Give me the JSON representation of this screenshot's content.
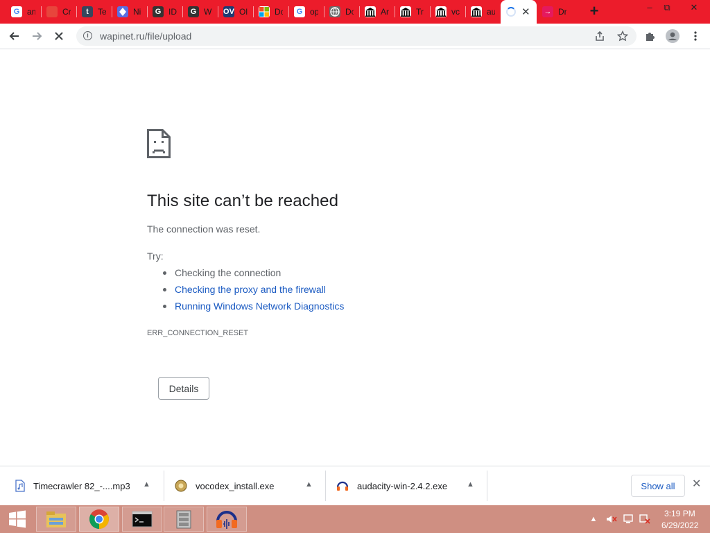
{
  "window": {
    "minimize_glyph": "–",
    "restore_glyph": "⧉",
    "close_glyph": "✕"
  },
  "tabs": [
    {
      "title": "an",
      "icon": "google-icon",
      "icon_text": "G",
      "icon_color": "#4285f4",
      "icon_bg": "#ffffff"
    },
    {
      "title": "Cr",
      "icon": "red-square-icon",
      "icon_text": "",
      "icon_color": "#ffffff",
      "icon_bg": "#e8453c"
    },
    {
      "title": "Te",
      "icon": "tumblr-icon",
      "icon_text": "t",
      "icon_color": "#ffffff",
      "icon_bg": "#36465d"
    },
    {
      "title": "Ni",
      "icon": "pen-nib-icon",
      "icon_text": "",
      "icon_color": "#ffffff",
      "icon_bg": "#5b6ee1"
    },
    {
      "title": "ID",
      "icon": "g-logo-icon",
      "icon_text": "G",
      "icon_color": "#ffffff",
      "icon_bg": "#333333"
    },
    {
      "title": "W",
      "icon": "g-logo-icon",
      "icon_text": "G",
      "icon_color": "#ffffff",
      "icon_bg": "#333333"
    },
    {
      "title": "Ol",
      "icon": "ov-icon",
      "icon_text": "OV",
      "icon_color": "#ffffff",
      "icon_bg": "#1f3b73"
    },
    {
      "title": "Dc",
      "icon": "microsoft-icon",
      "icon_text": "",
      "icon_color": "#ffffff",
      "icon_bg": "#ffffff"
    },
    {
      "title": "op",
      "icon": "google-icon",
      "icon_text": "G",
      "icon_color": "#4285f4",
      "icon_bg": "#ffffff"
    },
    {
      "title": "Do",
      "icon": "globe-icon",
      "icon_text": "",
      "icon_color": "#ffffff",
      "icon_bg": "#6b6b6b"
    },
    {
      "title": "Ar",
      "icon": "archive-icon",
      "icon_text": "",
      "icon_color": "#000000",
      "icon_bg": "#ffffff"
    },
    {
      "title": "Tr",
      "icon": "archive-icon",
      "icon_text": "",
      "icon_color": "#000000",
      "icon_bg": "#ffffff"
    },
    {
      "title": "vc",
      "icon": "archive-icon",
      "icon_text": "",
      "icon_color": "#000000",
      "icon_bg": "#ffffff"
    },
    {
      "title": "au",
      "icon": "archive-icon",
      "icon_text": "",
      "icon_color": "#000000",
      "icon_bg": "#ffffff"
    },
    {
      "title": "",
      "icon": "loading-spinner-icon",
      "icon_text": "",
      "icon_color": "#1a73e8",
      "icon_bg": "#ffffff",
      "active": true
    },
    {
      "title": "Dr",
      "icon": "arrow-right-icon",
      "icon_text": "→",
      "icon_color": "#ffffff",
      "icon_bg": "#e5195e"
    }
  ],
  "toolbar": {
    "url": "wapinet.ru/file/upload"
  },
  "error": {
    "title": "This site can’t be reached",
    "description": "The connection was reset.",
    "try_label": "Try:",
    "suggestions": [
      {
        "text": "Checking the connection",
        "link": false
      },
      {
        "text": "Checking the proxy and the firewall",
        "link": true
      },
      {
        "text": "Running Windows Network Diagnostics",
        "link": true
      }
    ],
    "code": "ERR_CONNECTION_RESET",
    "details_label": "Details"
  },
  "downloads": {
    "items": [
      {
        "name": "Timecrawler 82_-....mp3",
        "icon": "audio-file-icon"
      },
      {
        "name": "vocodex_install.exe",
        "icon": "installer-icon"
      },
      {
        "name": "audacity-win-2.4.2.exe",
        "icon": "audacity-icon"
      }
    ],
    "show_all_label": "Show all"
  },
  "taskbar": {
    "apps": [
      "file-explorer-icon",
      "chrome-icon",
      "command-prompt-icon",
      "archive-app-icon",
      "audacity-icon"
    ],
    "time": "3:19 PM",
    "date": "6/29/2022"
  },
  "colors": {
    "tabstrip": "#ec1c2b",
    "taskbar": "#cf8f82",
    "link": "#1a5ac2"
  }
}
